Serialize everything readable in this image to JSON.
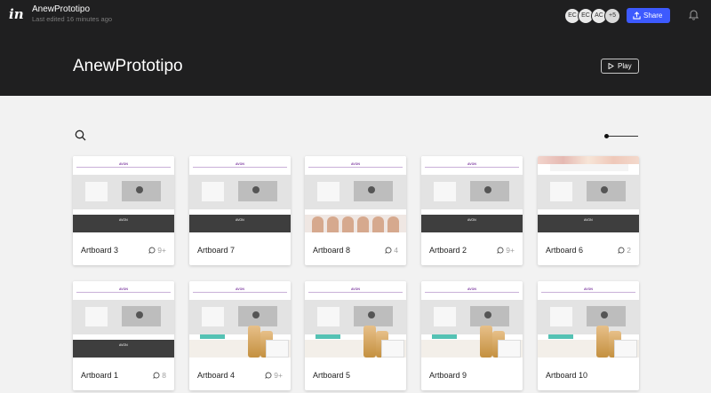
{
  "header": {
    "project_name": "AnewPrototipo",
    "last_edited": "Last edited 16 minutes ago",
    "avatars": [
      "EC",
      "EC",
      "AC",
      "+5"
    ],
    "share_label": "Share",
    "title": "AnewPrototipo",
    "play_label": "Play"
  },
  "colors": {
    "header_bg": "#1f1f20",
    "share_bg": "#3d5afe",
    "page_bg": "#f2f2f2"
  },
  "icons": [
    "invision-logo-icon",
    "share-icon",
    "bell-icon",
    "play-icon",
    "search-icon",
    "comment-icon"
  ],
  "thumbnail_brand": "AVON",
  "cards": [
    {
      "name": "Artboard 3",
      "comments": "9+"
    },
    {
      "name": "Artboard 7",
      "comments": ""
    },
    {
      "name": "Artboard 8",
      "comments": "4"
    },
    {
      "name": "Artboard 2",
      "comments": "9+"
    },
    {
      "name": "Artboard 6",
      "comments": "2"
    },
    {
      "name": "Artboard 1",
      "comments": "8"
    },
    {
      "name": "Artboard 4",
      "comments": "9+"
    },
    {
      "name": "Artboard 5",
      "comments": ""
    },
    {
      "name": "Artboard 9",
      "comments": ""
    },
    {
      "name": "Artboard 10",
      "comments": ""
    }
  ]
}
